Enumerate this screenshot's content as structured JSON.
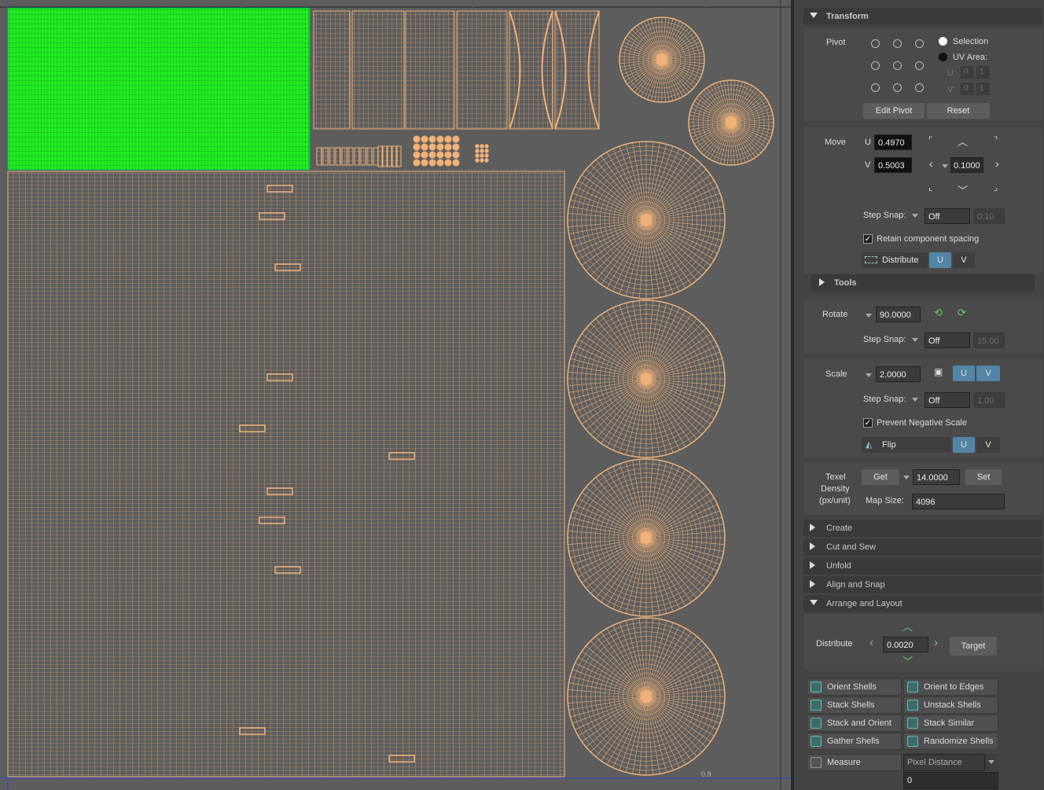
{
  "colors": {
    "uv_stroke": "#f0b27a",
    "selected": "#22ff22",
    "viewport_bg": "#5d5d5d",
    "accent": "#5285a6"
  },
  "viewport": {
    "axis_label": "0.9"
  },
  "transform": {
    "title": "Transform",
    "pivot_label": "Pivot",
    "selection": "Selection",
    "uv_area": "UV Area:",
    "u_label": "U:",
    "v_label": "V:",
    "u_min": "0",
    "u_max": "1",
    "v_min": "0",
    "v_max": "1",
    "edit_pivot": "Edit Pivot",
    "reset": "Reset",
    "move_label": "Move",
    "move_u_label": "U",
    "move_u": "0.4970",
    "move_v_label": "V",
    "move_v": "0.5003",
    "move_step": "0.1000",
    "step_snap_label": "Step Snap:",
    "move_snap": "Off",
    "move_snap_val": "0.10",
    "retain_spacing": "Retain component spacing",
    "distribute": "Distribute",
    "u": "U",
    "v": "V"
  },
  "tools": {
    "title": "Tools"
  },
  "rotate": {
    "label": "Rotate",
    "value": "90.0000",
    "snap": "Off",
    "snap_val": "15.00"
  },
  "scale": {
    "label": "Scale",
    "value": "2.0000",
    "snap": "Off",
    "snap_val": "1.00",
    "prevent_negative": "Prevent Negative Scale",
    "flip": "Flip"
  },
  "texel": {
    "label1": "Texel",
    "label2": "Density",
    "label3": "(px/unit)",
    "get": "Get",
    "value": "14.0000",
    "set": "Set",
    "map_size_label": "Map Size:",
    "map_size": "4096"
  },
  "sections": [
    "Create",
    "Cut and Sew",
    "Unfold",
    "Align and Snap",
    "Arrange and Layout"
  ],
  "arrange": {
    "distribute_label": "Distribute",
    "value": "0.0020",
    "target": "Target",
    "buttons": [
      "Orient Shells",
      "Orient to Edges",
      "Stack Shells",
      "Unstack Shells",
      "Stack and Orient",
      "Stack Similar",
      "Gather Shells",
      "Randomize Shells"
    ],
    "measure": "Measure",
    "measure_mode": "Pixel Distance",
    "measure_value": "0"
  }
}
